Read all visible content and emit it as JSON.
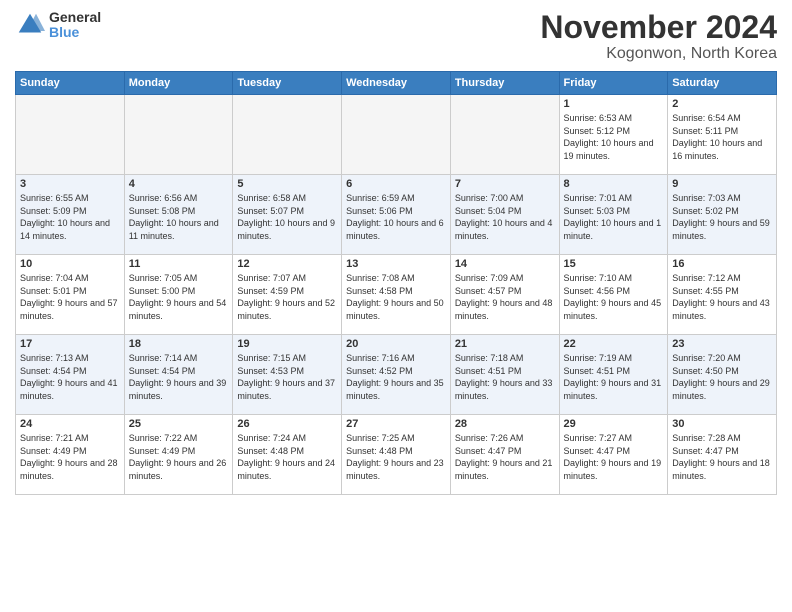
{
  "header": {
    "logo": {
      "general": "General",
      "blue": "Blue"
    },
    "title": "November 2024",
    "location": "Kogonwon, North Korea"
  },
  "days_of_week": [
    "Sunday",
    "Monday",
    "Tuesday",
    "Wednesday",
    "Thursday",
    "Friday",
    "Saturday"
  ],
  "weeks": [
    [
      {
        "day": "",
        "info": "",
        "empty": true
      },
      {
        "day": "",
        "info": "",
        "empty": true
      },
      {
        "day": "",
        "info": "",
        "empty": true
      },
      {
        "day": "",
        "info": "",
        "empty": true
      },
      {
        "day": "",
        "info": "",
        "empty": true
      },
      {
        "day": "1",
        "info": "Sunrise: 6:53 AM\nSunset: 5:12 PM\nDaylight: 10 hours and 19 minutes."
      },
      {
        "day": "2",
        "info": "Sunrise: 6:54 AM\nSunset: 5:11 PM\nDaylight: 10 hours and 16 minutes."
      }
    ],
    [
      {
        "day": "3",
        "info": "Sunrise: 6:55 AM\nSunset: 5:09 PM\nDaylight: 10 hours and 14 minutes."
      },
      {
        "day": "4",
        "info": "Sunrise: 6:56 AM\nSunset: 5:08 PM\nDaylight: 10 hours and 11 minutes."
      },
      {
        "day": "5",
        "info": "Sunrise: 6:58 AM\nSunset: 5:07 PM\nDaylight: 10 hours and 9 minutes."
      },
      {
        "day": "6",
        "info": "Sunrise: 6:59 AM\nSunset: 5:06 PM\nDaylight: 10 hours and 6 minutes."
      },
      {
        "day": "7",
        "info": "Sunrise: 7:00 AM\nSunset: 5:04 PM\nDaylight: 10 hours and 4 minutes."
      },
      {
        "day": "8",
        "info": "Sunrise: 7:01 AM\nSunset: 5:03 PM\nDaylight: 10 hours and 1 minute."
      },
      {
        "day": "9",
        "info": "Sunrise: 7:03 AM\nSunset: 5:02 PM\nDaylight: 9 hours and 59 minutes."
      }
    ],
    [
      {
        "day": "10",
        "info": "Sunrise: 7:04 AM\nSunset: 5:01 PM\nDaylight: 9 hours and 57 minutes."
      },
      {
        "day": "11",
        "info": "Sunrise: 7:05 AM\nSunset: 5:00 PM\nDaylight: 9 hours and 54 minutes."
      },
      {
        "day": "12",
        "info": "Sunrise: 7:07 AM\nSunset: 4:59 PM\nDaylight: 9 hours and 52 minutes."
      },
      {
        "day": "13",
        "info": "Sunrise: 7:08 AM\nSunset: 4:58 PM\nDaylight: 9 hours and 50 minutes."
      },
      {
        "day": "14",
        "info": "Sunrise: 7:09 AM\nSunset: 4:57 PM\nDaylight: 9 hours and 48 minutes."
      },
      {
        "day": "15",
        "info": "Sunrise: 7:10 AM\nSunset: 4:56 PM\nDaylight: 9 hours and 45 minutes."
      },
      {
        "day": "16",
        "info": "Sunrise: 7:12 AM\nSunset: 4:55 PM\nDaylight: 9 hours and 43 minutes."
      }
    ],
    [
      {
        "day": "17",
        "info": "Sunrise: 7:13 AM\nSunset: 4:54 PM\nDaylight: 9 hours and 41 minutes."
      },
      {
        "day": "18",
        "info": "Sunrise: 7:14 AM\nSunset: 4:54 PM\nDaylight: 9 hours and 39 minutes."
      },
      {
        "day": "19",
        "info": "Sunrise: 7:15 AM\nSunset: 4:53 PM\nDaylight: 9 hours and 37 minutes."
      },
      {
        "day": "20",
        "info": "Sunrise: 7:16 AM\nSunset: 4:52 PM\nDaylight: 9 hours and 35 minutes."
      },
      {
        "day": "21",
        "info": "Sunrise: 7:18 AM\nSunset: 4:51 PM\nDaylight: 9 hours and 33 minutes."
      },
      {
        "day": "22",
        "info": "Sunrise: 7:19 AM\nSunset: 4:51 PM\nDaylight: 9 hours and 31 minutes."
      },
      {
        "day": "23",
        "info": "Sunrise: 7:20 AM\nSunset: 4:50 PM\nDaylight: 9 hours and 29 minutes."
      }
    ],
    [
      {
        "day": "24",
        "info": "Sunrise: 7:21 AM\nSunset: 4:49 PM\nDaylight: 9 hours and 28 minutes."
      },
      {
        "day": "25",
        "info": "Sunrise: 7:22 AM\nSunset: 4:49 PM\nDaylight: 9 hours and 26 minutes."
      },
      {
        "day": "26",
        "info": "Sunrise: 7:24 AM\nSunset: 4:48 PM\nDaylight: 9 hours and 24 minutes."
      },
      {
        "day": "27",
        "info": "Sunrise: 7:25 AM\nSunset: 4:48 PM\nDaylight: 9 hours and 23 minutes."
      },
      {
        "day": "28",
        "info": "Sunrise: 7:26 AM\nSunset: 4:47 PM\nDaylight: 9 hours and 21 minutes."
      },
      {
        "day": "29",
        "info": "Sunrise: 7:27 AM\nSunset: 4:47 PM\nDaylight: 9 hours and 19 minutes."
      },
      {
        "day": "30",
        "info": "Sunrise: 7:28 AM\nSunset: 4:47 PM\nDaylight: 9 hours and 18 minutes."
      }
    ]
  ]
}
